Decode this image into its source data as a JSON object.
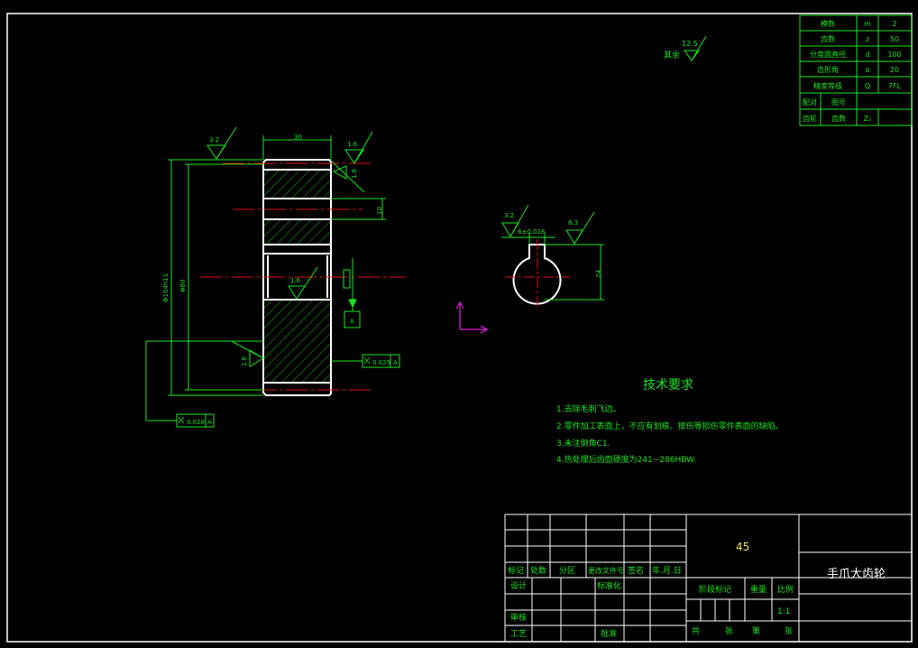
{
  "parameter_table": {
    "rows": [
      {
        "name": "模数",
        "symbol": "m",
        "value": "2"
      },
      {
        "name": "齿数",
        "symbol": "z",
        "value": "50"
      },
      {
        "name": "分度圆直径",
        "symbol": "d",
        "value": "100"
      },
      {
        "name": "齿形角",
        "symbol": "α",
        "value": "20"
      },
      {
        "name": "精度等级",
        "symbol": "Q",
        "value": "7FL"
      }
    ],
    "mating_label": "配对",
    "figure_no_label": "图号",
    "gear_label": "齿轮",
    "teeth_label": "齿数",
    "teeth_symbol": "Z₂"
  },
  "surface_finish": {
    "rest_label": "其余",
    "rest_value": "12.5",
    "left_face": "3.2",
    "right_face": "1.6",
    "tooth_face": "1.6",
    "bore": "1.6",
    "outer": "1.6",
    "keyway_side": "3.2",
    "keyway_top": "6.3"
  },
  "dimensions": {
    "width": "30",
    "tip_diameter": "Φ104h11",
    "root_diameter": "Φ80",
    "keyway_width": "6±0.018",
    "keyway_depth": "24",
    "hub_height": "10",
    "datum": "A"
  },
  "tolerances": {
    "runout_right_value": "0.025",
    "runout_right_datum": "A",
    "runout_left_value": "0.028",
    "runout_left_datum": "A"
  },
  "tech_requirements": {
    "heading": "技术要求",
    "items": [
      "1.去除毛刺飞边。",
      "2.零件加工表面上，不应有划痕、擦伤等损伤零件表面的缺陷。",
      "3.未注倒角C1.",
      "4.热处理后齿面硬度为241~286HBW."
    ]
  },
  "title_block": {
    "material": "45",
    "part_name": "手爪大齿轮",
    "header_row": [
      "标记",
      "处数",
      "分区",
      "更改文件号",
      "签名",
      "年.月.日"
    ],
    "design_label": "设计",
    "standardize_label": "标准化",
    "review_label": "审核",
    "process_label": "工艺",
    "approve_label": "批准",
    "stage_label": "阶段标记",
    "weight_label": "重量",
    "scale_label": "比例",
    "scale_value": "1:1",
    "sheets_total": "共",
    "sheets_unit": "张",
    "sheet_no": "第",
    "sheet_unit": "张"
  },
  "colors": {
    "background": "#000000",
    "dimension_green": "#1ee61e",
    "outline_white": "#ffffff",
    "centerline_red": "#e01010",
    "ucs_magenta": "#e020e0"
  }
}
